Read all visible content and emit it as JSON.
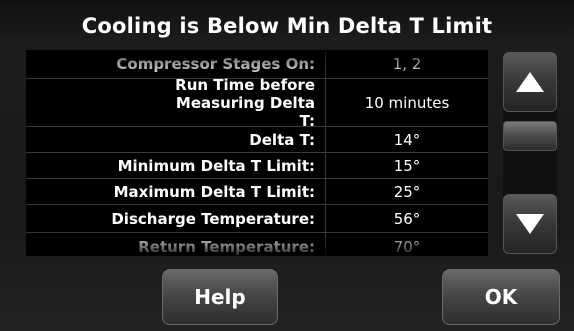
{
  "header": {
    "title": "Cooling is Below Min Delta T Limit"
  },
  "table": {
    "rows": [
      {
        "label": "Compressor Stages On:",
        "value": "1, 2"
      },
      {
        "label": "Run Time before Measuring Delta T:",
        "value": "10 minutes"
      },
      {
        "label": "Delta T:",
        "value": "14°"
      },
      {
        "label": "Minimum Delta T Limit:",
        "value": "15°"
      },
      {
        "label": "Maximum Delta T Limit:",
        "value": "25°"
      },
      {
        "label": "Discharge Temperature:",
        "value": "56°"
      },
      {
        "label": "Return Temperature:",
        "value": "70°"
      }
    ]
  },
  "scroll": {
    "up_icon": "triangle-up",
    "down_icon": "triangle-down"
  },
  "buttons": {
    "help_label": "Help",
    "ok_label": "OK"
  }
}
